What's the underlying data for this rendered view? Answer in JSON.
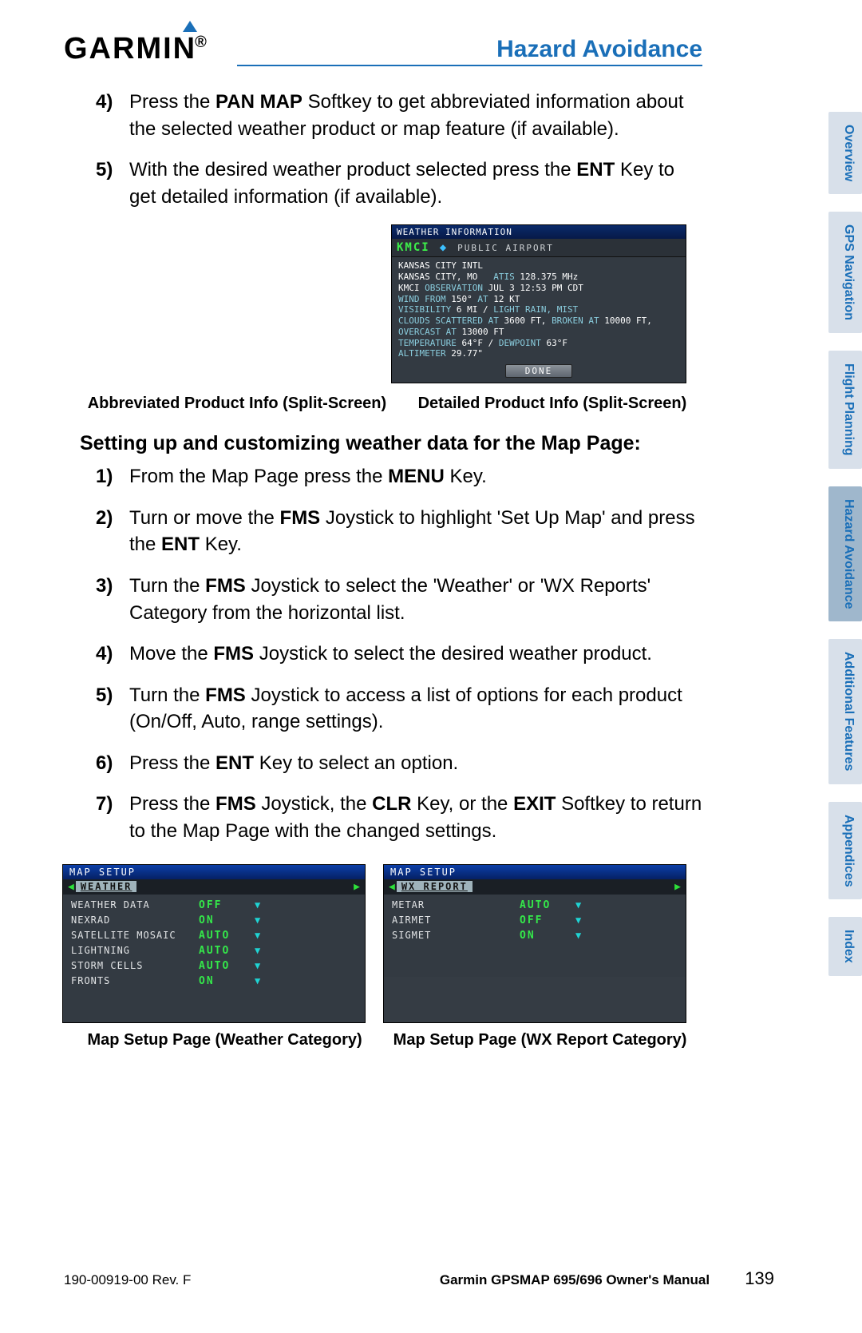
{
  "header": {
    "logo_text": "GARMIN",
    "section_title": "Hazard Avoidance"
  },
  "steps_top": [
    {
      "num": "4)",
      "parts": [
        "Press the ",
        {
          "b": "PAN MAP"
        },
        " Softkey to get abbreviated information about the selected weather product or map feature (if available)."
      ]
    },
    {
      "num": "5)",
      "parts": [
        "With the desired weather product selected press the ",
        {
          "b": "ENT"
        },
        " Key to get detailed information (if available)."
      ]
    }
  ],
  "weather_info": {
    "top": "WEATHER INFORMATION",
    "code": "KMCI",
    "type": "PUBLIC AIRPORT",
    "lines": [
      [
        {
          "v": "KANSAS CITY INTL"
        }
      ],
      [
        {
          "v": "KANSAS CITY, MO   "
        },
        {
          "l": "ATIS "
        },
        {
          "v": "128.375 MHz"
        }
      ],
      [
        {
          "v": ""
        }
      ],
      [
        {
          "v": "KMCI "
        },
        {
          "l": "OBSERVATION "
        },
        {
          "v": "JUL 3 12:53 PM CDT"
        }
      ],
      [
        {
          "l": "WIND FROM "
        },
        {
          "v": "150° "
        },
        {
          "l": "AT "
        },
        {
          "v": "12 KT"
        }
      ],
      [
        {
          "l": "VISIBILITY "
        },
        {
          "v": "6 MI / "
        },
        {
          "l": "LIGHT RAIN, MIST"
        }
      ],
      [
        {
          "l": "CLOUDS SCATTERED AT "
        },
        {
          "v": "3600 FT, "
        },
        {
          "l": "BROKEN AT "
        },
        {
          "v": "10000 FT,"
        }
      ],
      [
        {
          "l": "OVERCAST AT "
        },
        {
          "v": "13000 FT"
        }
      ],
      [
        {
          "l": "TEMPERATURE "
        },
        {
          "v": "64°F / "
        },
        {
          "l": "DEWPOINT "
        },
        {
          "v": "63°F"
        }
      ],
      [
        {
          "l": "ALTIMETER "
        },
        {
          "v": "29.77\""
        }
      ]
    ],
    "done": "DONE"
  },
  "captions_top": {
    "left": "Abbreviated Product Info (Split-Screen)",
    "right": "Detailed Product Info (Split-Screen)"
  },
  "subhead": "Setting up and customizing weather data for the Map Page:",
  "steps_main": [
    {
      "num": "1)",
      "parts": [
        "From the Map Page press the ",
        {
          "b": "MENU"
        },
        " Key."
      ]
    },
    {
      "num": "2)",
      "parts": [
        "Turn or move the ",
        {
          "b": "FMS"
        },
        " Joystick to highlight 'Set Up Map' and press the ",
        {
          "b": "ENT"
        },
        " Key."
      ]
    },
    {
      "num": "3)",
      "parts": [
        "Turn the ",
        {
          "b": "FMS"
        },
        " Joystick to select the 'Weather' or 'WX Reports' Category from the horizontal list."
      ]
    },
    {
      "num": "4)",
      "parts": [
        "Move the ",
        {
          "b": "FMS"
        },
        " Joystick to select the desired weather product."
      ]
    },
    {
      "num": "5)",
      "parts": [
        "Turn the ",
        {
          "b": "FMS"
        },
        " Joystick to access a list of options for each product (On/Off, Auto, range settings)."
      ]
    },
    {
      "num": "6)",
      "parts": [
        "Press the ",
        {
          "b": "ENT"
        },
        " Key to select an option."
      ]
    },
    {
      "num": "7)",
      "parts": [
        "Press the ",
        {
          "b": "FMS"
        },
        " Joystick, the ",
        {
          "b": "CLR"
        },
        " Key, or the ",
        {
          "b": "EXIT"
        },
        " Softkey to return to the Map Page with the changed settings."
      ]
    }
  ],
  "map_setup_left": {
    "top": "MAP SETUP",
    "tab": "WEATHER",
    "rows": [
      {
        "name": "WEATHER DATA",
        "val": "OFF"
      },
      {
        "name": "NEXRAD",
        "val": "ON"
      },
      {
        "name": "SATELLITE MOSAIC",
        "val": "AUTO"
      },
      {
        "name": "LIGHTNING",
        "val": "AUTO"
      },
      {
        "name": "STORM CELLS",
        "val": "AUTO"
      },
      {
        "name": "FRONTS",
        "val": "ON"
      }
    ]
  },
  "map_setup_right": {
    "top": "MAP SETUP",
    "tab": "WX REPORT",
    "rows": [
      {
        "name": "METAR",
        "val": "AUTO"
      },
      {
        "name": "AIRMET",
        "val": "OFF"
      },
      {
        "name": "SIGMET",
        "val": "ON"
      }
    ]
  },
  "captions_bottom": {
    "left": "Map Setup Page (Weather Category)",
    "right": "Map Setup Page (WX Report Category)"
  },
  "sidetabs": [
    {
      "label": "Overview",
      "active": false
    },
    {
      "label": "GPS Navigation",
      "active": false
    },
    {
      "label": "Flight Planning",
      "active": false
    },
    {
      "label": "Hazard Avoidance",
      "active": true
    },
    {
      "label": "Additional Features",
      "active": false
    },
    {
      "label": "Appendices",
      "active": false
    },
    {
      "label": "Index",
      "active": false
    }
  ],
  "footer": {
    "rev": "190-00919-00 Rev. F",
    "manual": "Garmin GPSMAP 695/696 Owner's Manual",
    "page": "139"
  }
}
